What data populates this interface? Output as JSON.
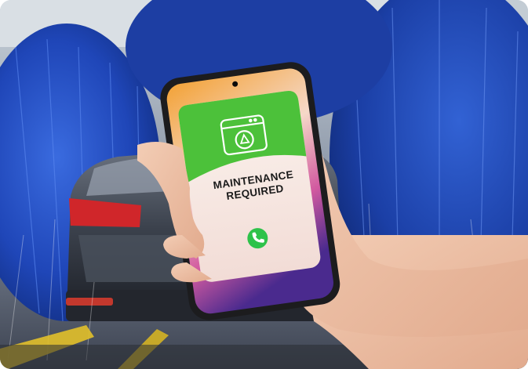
{
  "alert": {
    "icon": "settings-warning-icon",
    "title": "MAINTENANCE\nREQUIRED",
    "call_icon": "phone-icon"
  },
  "colors": {
    "header_green": "#4cc13a",
    "call_green": "#2ec24a",
    "brush_blue": "#1f46b8",
    "phone_frame": "#1c1c1e",
    "card_bg": "#f8ece6",
    "taillight_red": "#d0262a"
  }
}
